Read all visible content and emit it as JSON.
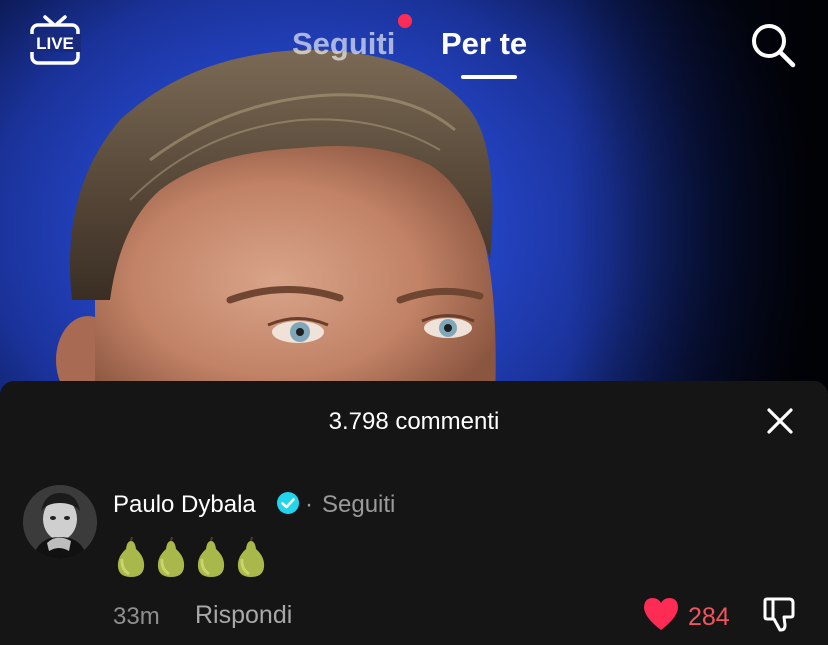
{
  "topnav": {
    "live_label": "LIVE",
    "tabs": [
      {
        "label": "Seguiti",
        "has_notification_dot": true
      },
      {
        "label": "Per te",
        "active": true
      }
    ],
    "search_icon": "search-icon"
  },
  "comments_sheet": {
    "title": "3.798 commenti",
    "close_icon": "close-icon",
    "comments": [
      {
        "author": "Paulo Dybala",
        "verified": true,
        "separator": "·",
        "follow_status": "Seguiti",
        "text_emoji": "🍐🍐🍐🍐",
        "time": "33m",
        "reply_label": "Rispondi",
        "likes": "284",
        "liked": true
      }
    ]
  },
  "colors": {
    "like_red": "#fe2c55",
    "notification_dot": "#fe2c55",
    "sheet_bg": "#151515",
    "verified_blue": "#20d5ec"
  }
}
